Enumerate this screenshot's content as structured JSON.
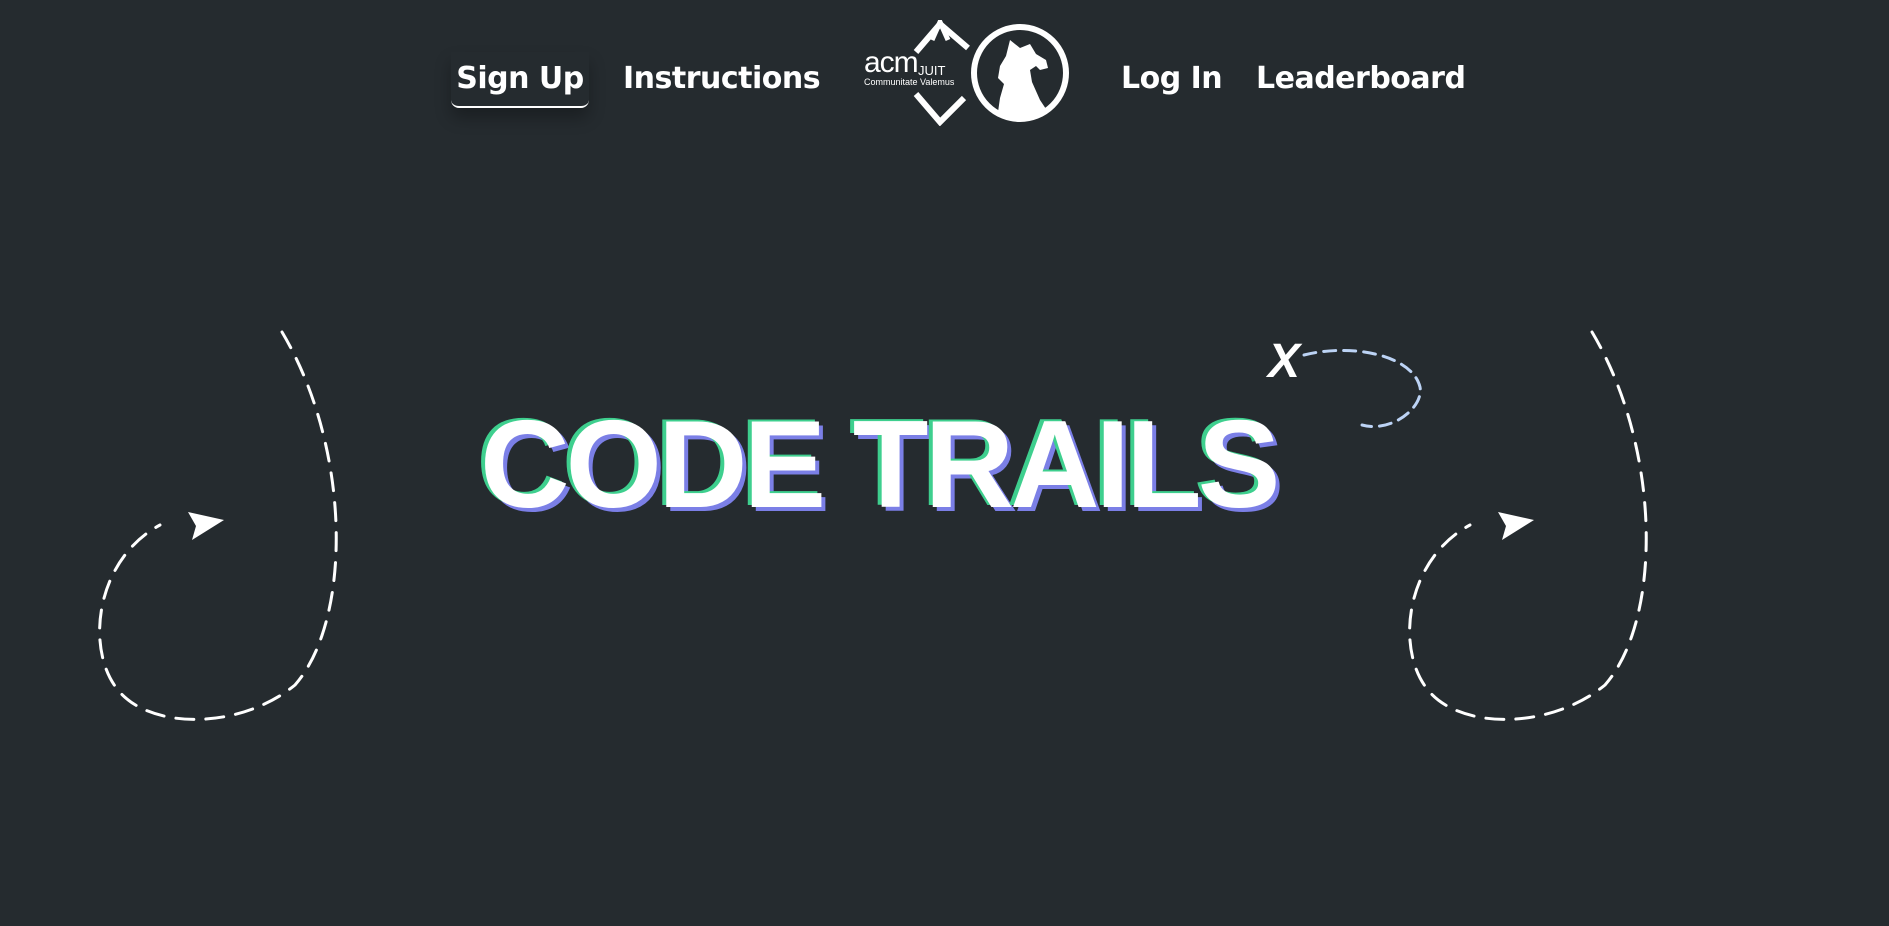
{
  "nav": {
    "signup_label": "Sign Up",
    "instructions_label": "Instructions",
    "login_label": "Log In",
    "leaderboard_label": "Leaderboard"
  },
  "logo": {
    "acm_text": "acm",
    "juit_text": "JUIT",
    "motto_text": "Communitate Valemus",
    "icon": "acm-wolf-logo-icon"
  },
  "hero": {
    "title": "CODE TRAILS",
    "mark": "X"
  },
  "colors": {
    "background": "#252b2f",
    "text": "#ffffff",
    "accent_green": "#3ecf8e",
    "accent_purple": "#7b7fe6",
    "trail_blue": "#bcd3f5"
  }
}
